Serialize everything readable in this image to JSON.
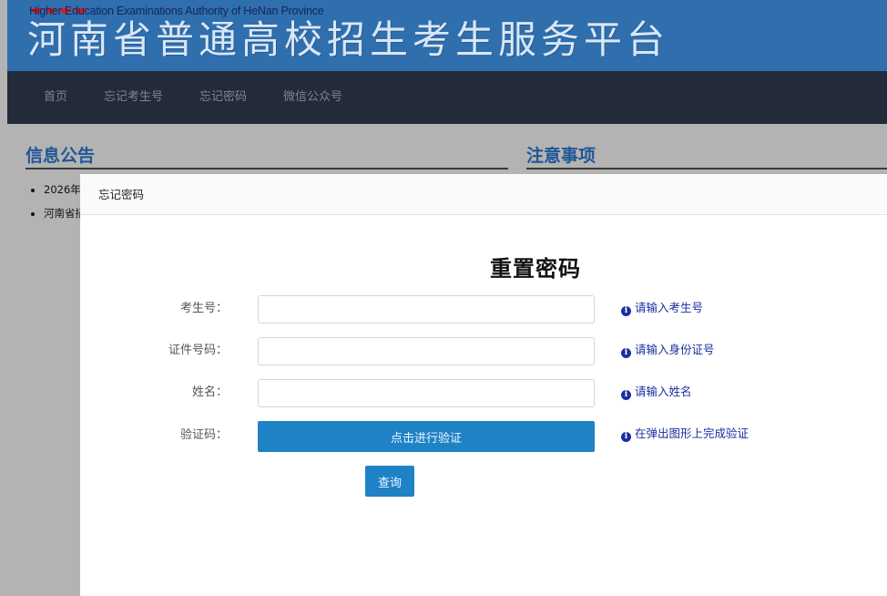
{
  "banner": {
    "title_en": "Higher Education Examinations Authority of HeNan Province",
    "title_cn": "河南省普通高校招生考生服务平台"
  },
  "nav": {
    "items": [
      {
        "label": "首页"
      },
      {
        "label": "忘记考生号"
      },
      {
        "label": "忘记密码"
      },
      {
        "label": "微信公众号"
      }
    ]
  },
  "page": {
    "info_title": "信息公告",
    "notes_title": "注意事项",
    "notices": [
      "2026年",
      "河南省招"
    ]
  },
  "modal": {
    "header": "忘记密码",
    "title": "重置密码",
    "fields": {
      "exam_no": {
        "label": "考生号：",
        "value": "",
        "hint": "请输入考生号"
      },
      "id_no": {
        "label": "证件号码：",
        "value": "",
        "hint": "请输入身份证号"
      },
      "name": {
        "label": "姓名：",
        "value": "",
        "hint": "请输入姓名"
      },
      "captcha": {
        "label": "验证码：",
        "button": "点击进行验证",
        "hint": "在弹出图形上完成验证"
      }
    },
    "submit_label": "查询"
  },
  "colors": {
    "banner_bg": "#2f6fae",
    "nav_bg": "#232a3a",
    "primary_button": "#1f82c6",
    "hint_text": "#1a2fa0",
    "section_title": "#1e5796"
  },
  "icons": {
    "hint_icon": "info-circle-icon"
  }
}
